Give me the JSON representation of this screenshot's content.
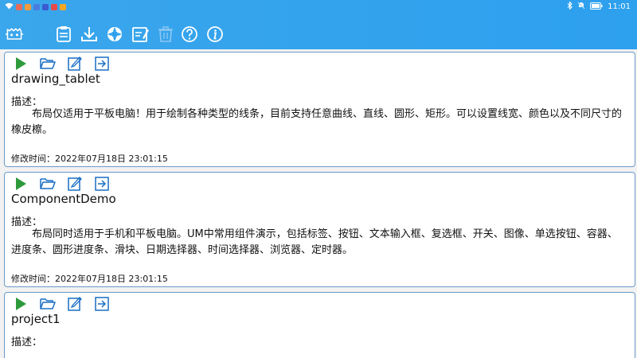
{
  "status_bar": {
    "time": "11:01",
    "battery_level": "full",
    "left_icons": [
      "wifi-icon",
      "app-icon-1",
      "app-icon-2",
      "app-icon-3",
      "app-icon-4",
      "app-icon-5",
      "app-icon-6"
    ],
    "right_icons": [
      "bluetooth-icon",
      "mute-icon",
      "battery-icon"
    ]
  },
  "toolbar": {
    "buttons": [
      {
        "name": "app-logo",
        "icon": "robot-logo-icon"
      },
      {
        "name": "clipboard-button",
        "icon": "clipboard-icon"
      },
      {
        "name": "download-button",
        "icon": "download-icon"
      },
      {
        "name": "help-ring-button",
        "icon": "lifebuoy-icon"
      },
      {
        "name": "edit-button",
        "icon": "edit-icon"
      },
      {
        "name": "delete-button",
        "icon": "trash-icon",
        "disabled": true
      },
      {
        "name": "help-button",
        "icon": "question-icon"
      },
      {
        "name": "info-button",
        "icon": "info-icon"
      }
    ]
  },
  "colors": {
    "header": "#2da0ee",
    "card_border": "#6a9ac8",
    "run_icon": "#2e9a3c",
    "action_icon": "#1a6fc4"
  },
  "projects": [
    {
      "name": "drawing_tablet",
      "desc_label": "描述：",
      "description": "布局仅适用于平板电脑！用于绘制各种类型的线条，目前支持任意曲线、直线、圆形、矩形。可以设置线宽、颜色以及不同尺寸的橡皮檫。",
      "modified_label": "修改时间：",
      "modified": "2022年07月18日 23:01:15"
    },
    {
      "name": "ComponentDemo",
      "desc_label": "描述：",
      "description": "布局同时适用于手机和平板电脑。UM中常用组件演示，包括标签、按钮、文本输入框、复选框、开关、图像、单选按钮、容器、进度条、圆形进度条、滑块、日期选择器、时间选择器、浏览器、定时器。",
      "modified_label": "修改时间：",
      "modified": "2022年07月18日 23:01:15"
    },
    {
      "name": "project1",
      "desc_label": "描述：",
      "description": "",
      "modified_label": "",
      "modified": ""
    }
  ]
}
